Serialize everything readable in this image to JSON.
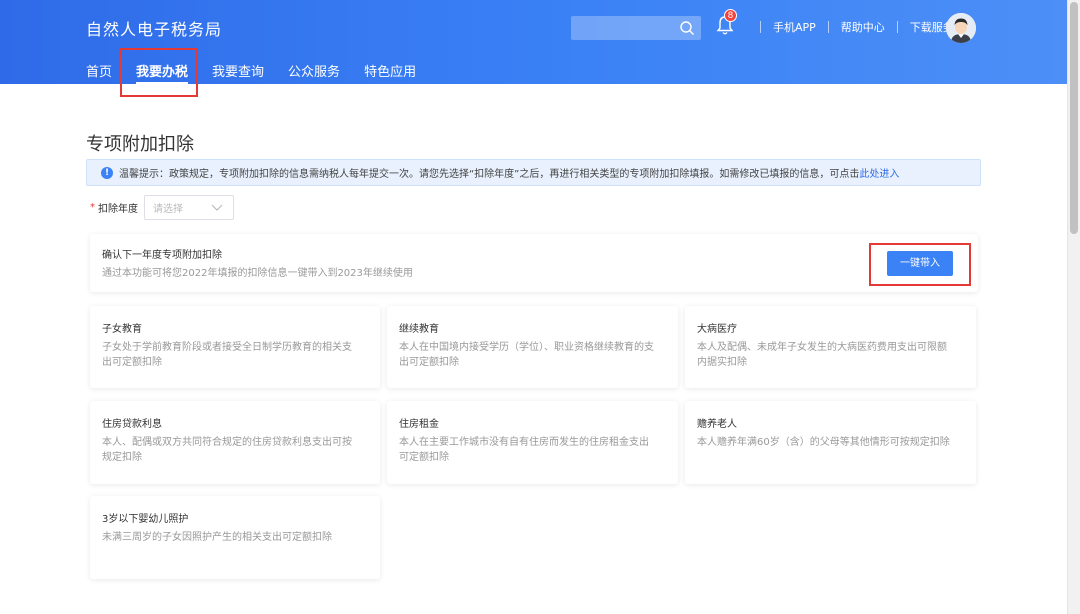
{
  "header": {
    "site_title": "自然人电子税务局",
    "notification_count": "8",
    "links": [
      "手机APP",
      "帮助中心",
      "下载服务"
    ]
  },
  "nav": {
    "items": [
      "首页",
      "我要办税",
      "我要查询",
      "公众服务",
      "特色应用"
    ],
    "active_index": 1
  },
  "page": {
    "title": "专项附加扣除",
    "notice_text": "温馨提示：政策规定，专项附加扣除的信息需纳税人每年提交一次。请您先选择“扣除年度”之后，再进行相关类型的专项附加扣除填报。如需修改已填报的信息，可点击",
    "notice_link": "此处进入",
    "year_label": "扣除年度",
    "year_required_mark": "*",
    "year_placeholder": "请选择"
  },
  "confirm": {
    "title": "确认下一年度专项附加扣除",
    "desc": "通过本功能可将您2022年填报的扣除信息一键带入到2023年继续使用",
    "button": "一键带入"
  },
  "categories": [
    {
      "title": "子女教育",
      "desc": "子女处于学前教育阶段或者接受全日制学历教育的相关支出可定额扣除"
    },
    {
      "title": "继续教育",
      "desc": "本人在中国境内接受学历（学位）、职业资格继续教育的支出可定额扣除"
    },
    {
      "title": "大病医疗",
      "desc": "本人及配偶、未成年子女发生的大病医药费用支出可限额内据实扣除"
    },
    {
      "title": "住房贷款利息",
      "desc": "本人、配偶或双方共同符合规定的住房贷款利息支出可按规定扣除"
    },
    {
      "title": "住房租金",
      "desc": "本人在主要工作城市没有自有住房而发生的住房租金支出可定额扣除"
    },
    {
      "title": "赡养老人",
      "desc": "本人赡养年满60岁（含）的父母等其他情形可按规定扣除"
    },
    {
      "title": "3岁以下婴幼儿照护",
      "desc": "未满三周岁的子女因照护产生的相关支出可定额扣除"
    }
  ],
  "colors": {
    "primary": "#3b82f6",
    "highlight": "#e53935"
  }
}
